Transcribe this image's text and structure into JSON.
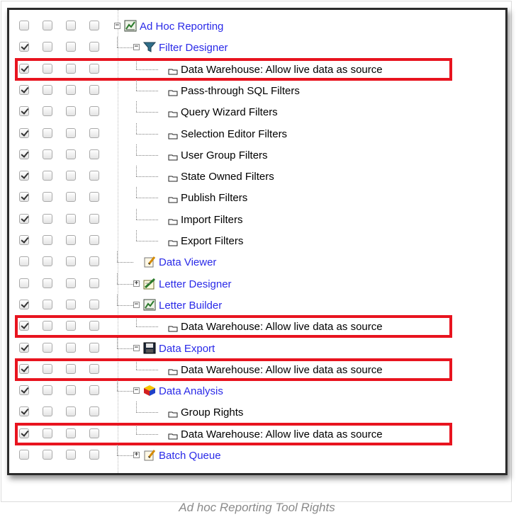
{
  "tree": {
    "rows": [
      {
        "label": "Ad Hoc Reporting",
        "checks": [
          false,
          false,
          false,
          false
        ],
        "type": "folder",
        "icon": "report-icon",
        "expander": "-",
        "link": true,
        "level": 0
      },
      {
        "label": "Filter Designer",
        "checks": [
          true,
          false,
          false,
          false
        ],
        "type": "folder",
        "icon": "filter-icon",
        "expander": "-",
        "link": true,
        "level": 1
      },
      {
        "label": "Data Warehouse: Allow live data as source",
        "checks": [
          true,
          false,
          false,
          false
        ],
        "type": "leaf",
        "icon": "tab-icon",
        "link": false,
        "level": 2,
        "highlight": true
      },
      {
        "label": "Pass-through SQL Filters",
        "checks": [
          true,
          false,
          false,
          false
        ],
        "type": "leaf",
        "icon": "tab-icon",
        "link": false,
        "level": 2
      },
      {
        "label": "Query Wizard Filters",
        "checks": [
          true,
          false,
          false,
          false
        ],
        "type": "leaf",
        "icon": "tab-icon",
        "link": false,
        "level": 2
      },
      {
        "label": "Selection Editor Filters",
        "checks": [
          true,
          false,
          false,
          false
        ],
        "type": "leaf",
        "icon": "tab-icon",
        "link": false,
        "level": 2
      },
      {
        "label": "User Group Filters",
        "checks": [
          true,
          false,
          false,
          false
        ],
        "type": "leaf",
        "icon": "tab-icon",
        "link": false,
        "level": 2
      },
      {
        "label": "State Owned Filters",
        "checks": [
          true,
          false,
          false,
          false
        ],
        "type": "leaf",
        "icon": "tab-icon",
        "link": false,
        "level": 2
      },
      {
        "label": "Publish Filters",
        "checks": [
          true,
          false,
          false,
          false
        ],
        "type": "leaf",
        "icon": "tab-icon",
        "link": false,
        "level": 2
      },
      {
        "label": "Import Filters",
        "checks": [
          true,
          false,
          false,
          false
        ],
        "type": "leaf",
        "icon": "tab-icon",
        "link": false,
        "level": 2
      },
      {
        "label": "Export Filters",
        "checks": [
          true,
          false,
          false,
          false
        ],
        "type": "leaf",
        "icon": "tab-icon",
        "link": false,
        "level": 2
      },
      {
        "label": "Data Viewer",
        "checks": [
          false,
          false,
          false,
          false
        ],
        "type": "folder",
        "icon": "pencil-note-icon",
        "expander": "",
        "link": true,
        "level": 1
      },
      {
        "label": "Letter Designer",
        "checks": [
          false,
          false,
          false,
          false
        ],
        "type": "folder",
        "icon": "letter-design-icon",
        "expander": "+",
        "link": true,
        "level": 1
      },
      {
        "label": "Letter Builder",
        "checks": [
          true,
          false,
          false,
          false
        ],
        "type": "folder",
        "icon": "report-icon",
        "expander": "-",
        "link": true,
        "level": 1
      },
      {
        "label": "Data Warehouse: Allow live data as source",
        "checks": [
          true,
          false,
          false,
          false
        ],
        "type": "leaf",
        "icon": "tab-icon",
        "link": false,
        "level": 2,
        "highlight": true
      },
      {
        "label": "Data Export",
        "checks": [
          true,
          false,
          false,
          false
        ],
        "type": "folder",
        "icon": "floppy-disk-icon",
        "expander": "-",
        "link": true,
        "level": 1
      },
      {
        "label": "Data Warehouse: Allow live data as source",
        "checks": [
          true,
          false,
          false,
          false
        ],
        "type": "leaf",
        "icon": "tab-icon",
        "link": false,
        "level": 2,
        "highlight": true
      },
      {
        "label": "Data Analysis",
        "checks": [
          true,
          false,
          false,
          false
        ],
        "type": "folder",
        "icon": "cube-icon",
        "expander": "-",
        "link": true,
        "level": 1
      },
      {
        "label": "Group Rights",
        "checks": [
          true,
          false,
          false,
          false
        ],
        "type": "leaf",
        "icon": "tab-icon",
        "link": false,
        "level": 2
      },
      {
        "label": "Data Warehouse: Allow live data as source",
        "checks": [
          true,
          false,
          false,
          false
        ],
        "type": "leaf",
        "icon": "tab-icon",
        "link": false,
        "level": 2,
        "highlight": true
      },
      {
        "label": "Batch Queue",
        "checks": [
          false,
          false,
          false,
          false
        ],
        "type": "folder",
        "icon": "pencil-note-icon",
        "expander": "+",
        "link": true,
        "level": 1
      }
    ]
  },
  "caption": "Ad hoc Reporting Tool Rights",
  "colors": {
    "link": "#2a2ae8",
    "highlight": "#e8141f",
    "text": "#000000"
  }
}
